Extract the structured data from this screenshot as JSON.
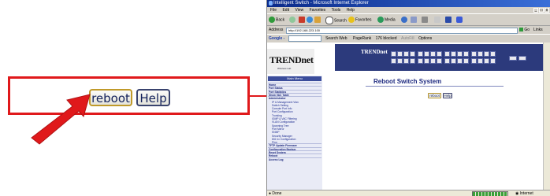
{
  "callout": {
    "reboot_label": "reboot",
    "help_label": "Help"
  },
  "window": {
    "title": "Intelligent Switch - Microsoft Internet Explorer",
    "controls": [
      "_",
      "□",
      "x"
    ],
    "menu": [
      "File",
      "Edit",
      "View",
      "Favorites",
      "Tools",
      "Help"
    ],
    "toolbar": {
      "back": "Back",
      "search": "Search",
      "favorites": "Favorites",
      "media": "Media"
    },
    "address_label": "Address",
    "address_value": "http://192.168.223.100",
    "go_label": "Go",
    "links_label": "Links",
    "google_bar": {
      "brand": "Google -",
      "search_web": "Search Web",
      "pagerank": "PageRank",
      "blocked": "176 blocked",
      "autofill": "AutoFill",
      "options": "Options"
    },
    "status": {
      "left": "Done",
      "right": "Internet"
    }
  },
  "page": {
    "logo": "TRENDnet",
    "logo_sub": "Wireless Lab",
    "switch_brand": "TRENDnet",
    "main_menu_label": "Main Menu",
    "title": "Reboot Switch System",
    "reboot_label": "reboot",
    "help_label": "Help",
    "nav_items": [
      {
        "label": "Home",
        "sub": false
      },
      {
        "label": "Port Status",
        "sub": false
      },
      {
        "label": "Port Statistics",
        "sub": false
      },
      {
        "label": "Show VAC Table",
        "sub": false
      },
      {
        "label": "Administrator",
        "sub": false
      },
      {
        "label": "IP & Management Vlan",
        "sub": true
      },
      {
        "label": "Switch Setting",
        "sub": true
      },
      {
        "label": "Console Port Info",
        "sub": true
      },
      {
        "label": "Port Configuration",
        "sub": true
      },
      {
        "label": "Trunking",
        "sub": true
      },
      {
        "label": "IGMP & VAC Filtering",
        "sub": true
      },
      {
        "label": "VLAN Configuration",
        "sub": true
      },
      {
        "label": "Spanning Tree",
        "sub": true
      },
      {
        "label": "Port Mirror",
        "sub": true
      },
      {
        "label": "SNMP",
        "sub": true
      },
      {
        "label": "Security Manager",
        "sub": true
      },
      {
        "label": "802.1x Configuration",
        "sub": true
      },
      {
        "label": "Ping",
        "sub": true
      },
      {
        "label": "TFTP Update Firmware",
        "sub": false
      },
      {
        "label": "Configuration Backup",
        "sub": false
      },
      {
        "label": "Reset System",
        "sub": false
      },
      {
        "label": "Reboot",
        "sub": false
      },
      {
        "label": "Access Log",
        "sub": false
      }
    ]
  },
  "colors": {
    "callout_red": "#e0191b",
    "title_blue": "#1e2a80",
    "switch_panel": "#2c3a7c",
    "ie_title": "#0a2a8a"
  },
  "icons": [
    "ie-logo-icon",
    "back-arrow-icon",
    "forward-arrow-icon",
    "stop-icon",
    "refresh-icon",
    "home-icon",
    "search-icon",
    "favorites-star-icon",
    "media-icon",
    "history-icon",
    "mail-icon",
    "print-icon",
    "go-arrow-icon",
    "internet-globe-icon"
  ]
}
